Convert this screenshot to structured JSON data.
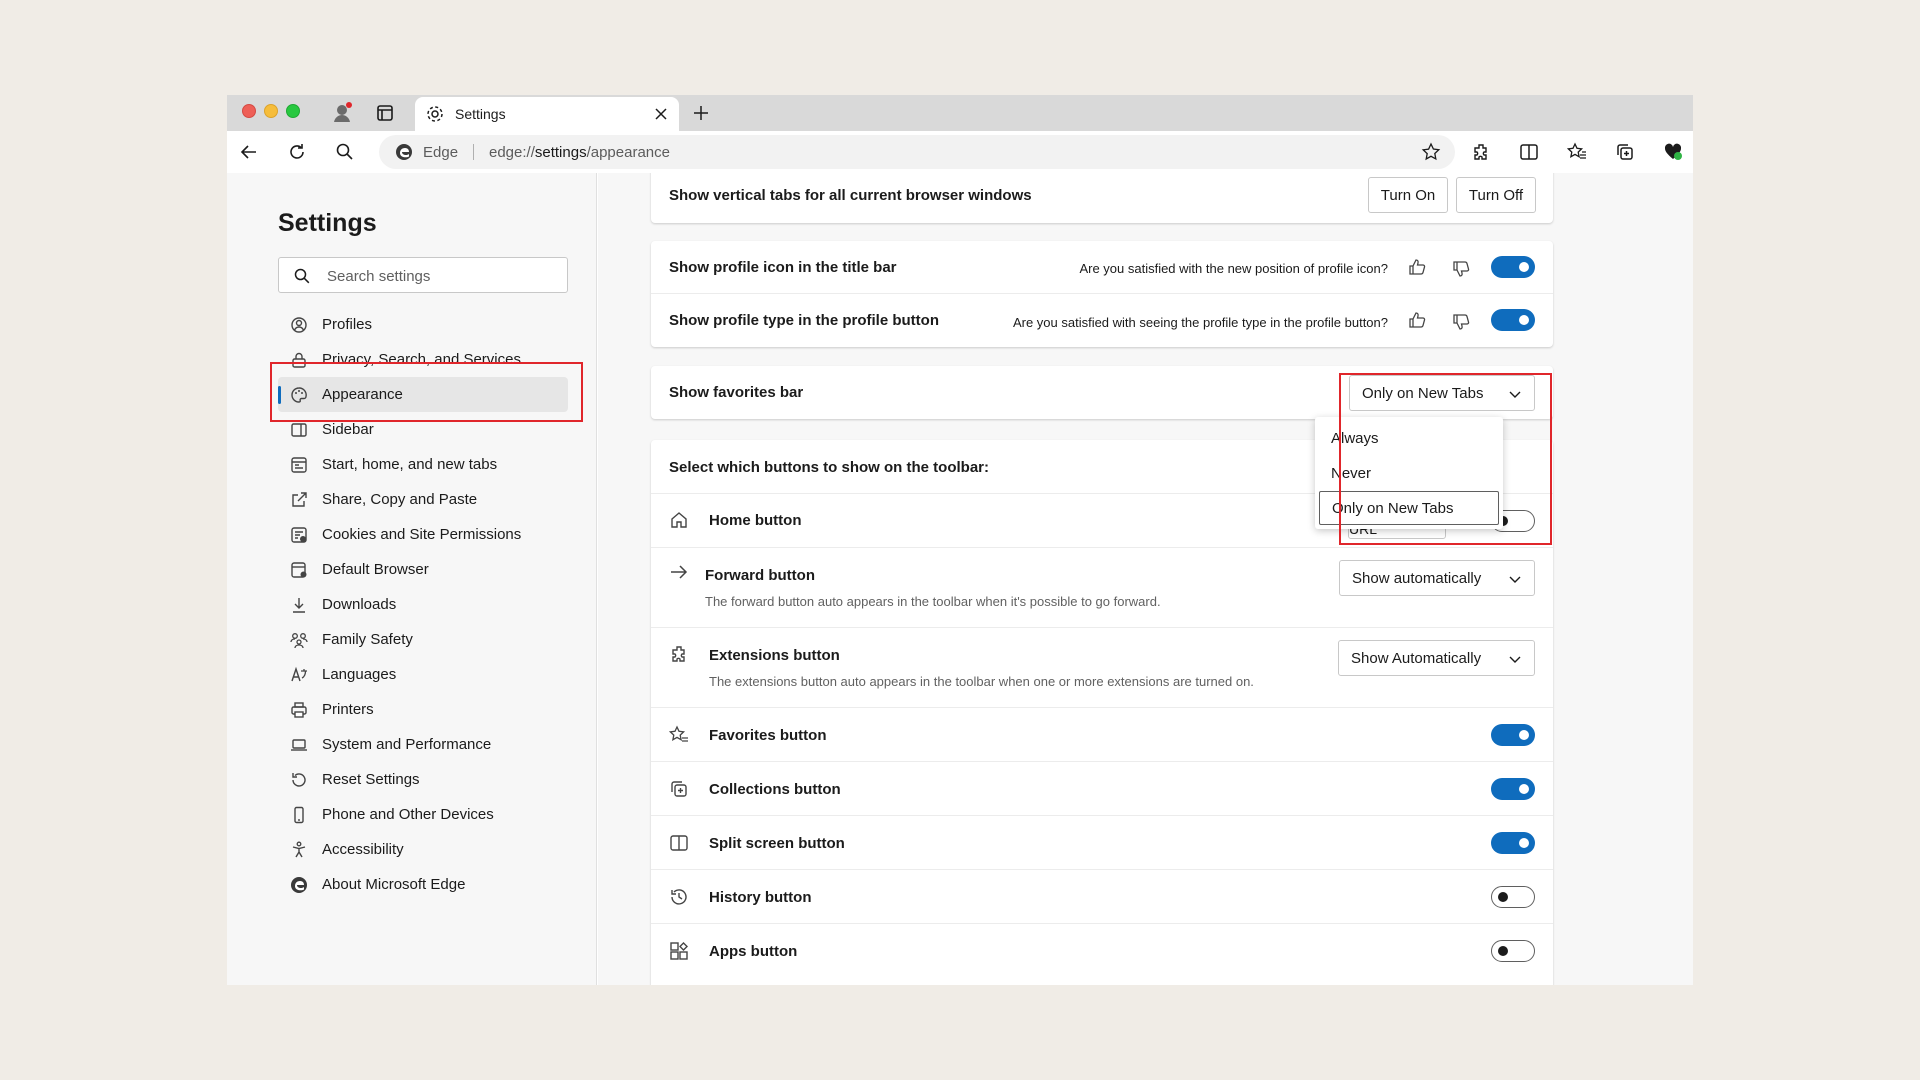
{
  "browser": {
    "tab_title": "Settings",
    "omnibox_brand": "Edge",
    "url_prefix": "edge://",
    "url_bold": "settings",
    "url_suffix": "/appearance"
  },
  "sidebar": {
    "title": "Settings",
    "search_placeholder": "Search settings",
    "items": [
      {
        "label": "Profiles",
        "icon": "profile-icon"
      },
      {
        "label": "Privacy, Search, and Services",
        "icon": "lock-icon"
      },
      {
        "label": "Appearance",
        "icon": "palette-icon",
        "active": true
      },
      {
        "label": "Sidebar",
        "icon": "sidebar-icon"
      },
      {
        "label": "Start, home, and new tabs",
        "icon": "home-tabs-icon"
      },
      {
        "label": "Share, Copy and Paste",
        "icon": "share-icon"
      },
      {
        "label": "Cookies and Site Permissions",
        "icon": "cookies-icon"
      },
      {
        "label": "Default Browser",
        "icon": "browser-icon"
      },
      {
        "label": "Downloads",
        "icon": "download-icon"
      },
      {
        "label": "Family Safety",
        "icon": "family-icon"
      },
      {
        "label": "Languages",
        "icon": "languages-icon"
      },
      {
        "label": "Printers",
        "icon": "printer-icon"
      },
      {
        "label": "System and Performance",
        "icon": "laptop-icon"
      },
      {
        "label": "Reset Settings",
        "icon": "reset-icon"
      },
      {
        "label": "Phone and Other Devices",
        "icon": "phone-icon"
      },
      {
        "label": "Accessibility",
        "icon": "accessibility-icon"
      },
      {
        "label": "About Microsoft Edge",
        "icon": "edge-icon"
      }
    ]
  },
  "vertical_tabs": {
    "title": "Show vertical tabs for all current browser windows",
    "turn_on": "Turn On",
    "turn_off": "Turn Off"
  },
  "profile": {
    "icon_title": "Show profile icon in the title bar",
    "icon_question": "Are you satisfied with the new position of profile icon?",
    "icon_toggle": true,
    "type_title": "Show profile type in the profile button",
    "type_question": "Are you satisfied with seeing the profile type in the profile button?",
    "type_toggle": true
  },
  "favorites_bar": {
    "title": "Show favorites bar",
    "selected": "Only on New Tabs",
    "options": [
      "Always",
      "Never",
      "Only on New Tabs"
    ]
  },
  "toolbar_buttons": {
    "heading": "Select which buttons to show on the toolbar:",
    "home": {
      "title": "Home button",
      "button": "Set Button URL"
    },
    "forward": {
      "title": "Forward button",
      "desc": "The forward button auto appears in the toolbar when it's possible to go forward.",
      "selected": "Show automatically"
    },
    "extensions": {
      "title": "Extensions button",
      "desc": "The extensions button auto appears in the toolbar when one or more extensions are turned on.",
      "selected": "Show Automatically"
    },
    "favorites": {
      "title": "Favorites button",
      "on": true
    },
    "collections": {
      "title": "Collections button",
      "on": true
    },
    "split": {
      "title": "Split screen button",
      "on": true
    },
    "history": {
      "title": "History button",
      "on": false
    },
    "apps": {
      "title": "Apps button",
      "on": false
    }
  },
  "colors": {
    "accent": "#0f6cbd",
    "highlight": "#e0262b"
  }
}
